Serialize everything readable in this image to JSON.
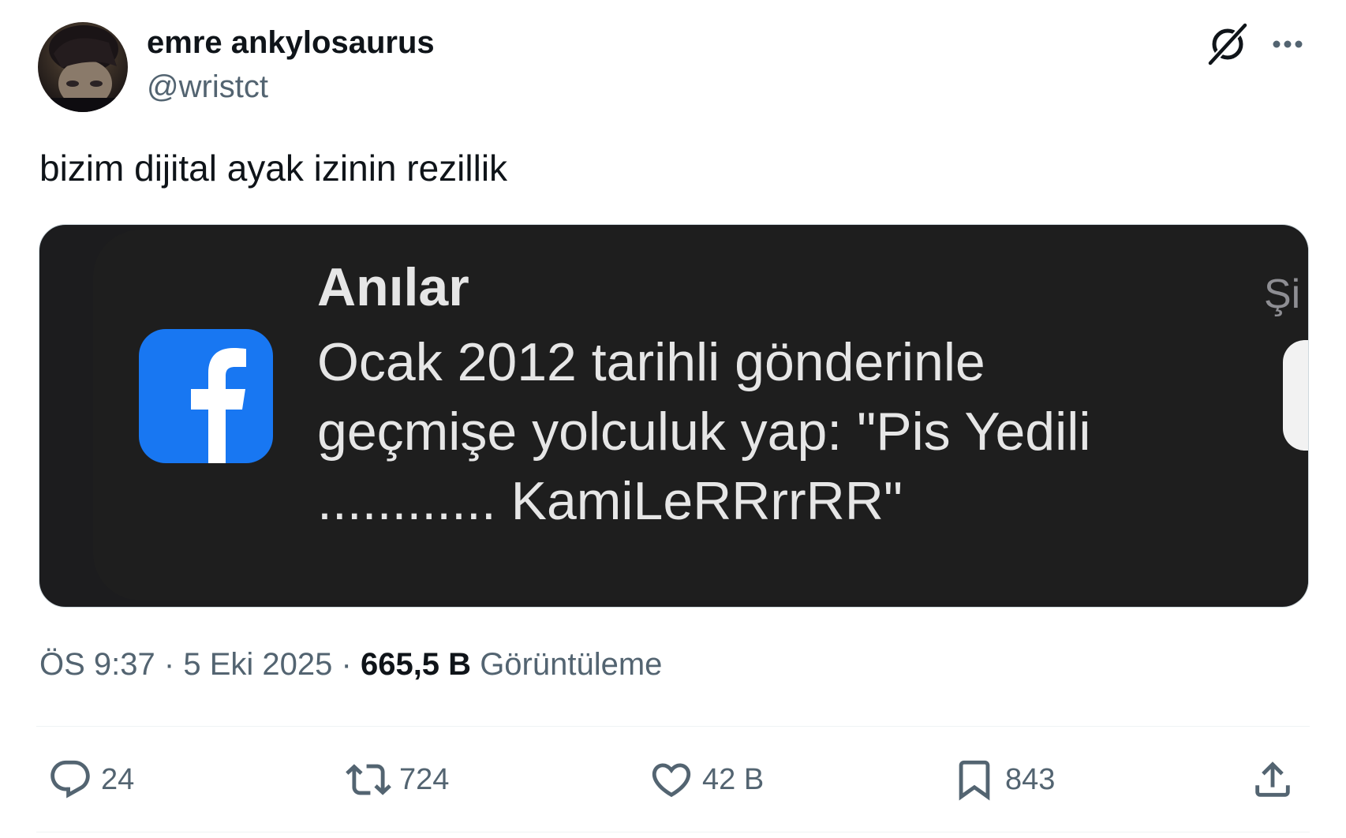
{
  "author": {
    "name": "emre ankylosaurus",
    "handle": "@wristct"
  },
  "icons": {
    "avatar": "avatar",
    "grok": "grok-icon",
    "more": "more-icon",
    "reply": "reply-icon",
    "retweet": "retweet-icon",
    "like": "heart-icon",
    "bookmark": "bookmark-icon",
    "share": "share-icon",
    "facebook": "facebook-icon"
  },
  "tweet": {
    "text": "bizim dijital ayak izinin rezillik"
  },
  "media": {
    "notification_title": "Anılar",
    "notification_body": "Ocak 2012 tarihli gönderinle geçmişe yolculuk yap: \"Pis Yedili ............ KamiLeRRrrRR\"",
    "notification_time": "Şi"
  },
  "meta": {
    "time": "ÖS 9:37",
    "separator": "·",
    "date": "5 Eki 2025",
    "views_count": "665,5 B",
    "views_label": "Görüntüleme"
  },
  "actions": {
    "replies": "24",
    "retweets": "724",
    "likes": "42 B",
    "bookmarks": "843"
  },
  "colors": {
    "text_primary": "#0f1419",
    "text_secondary": "#536471",
    "facebook_blue": "#1877f2",
    "media_background": "#1c1c1e"
  }
}
